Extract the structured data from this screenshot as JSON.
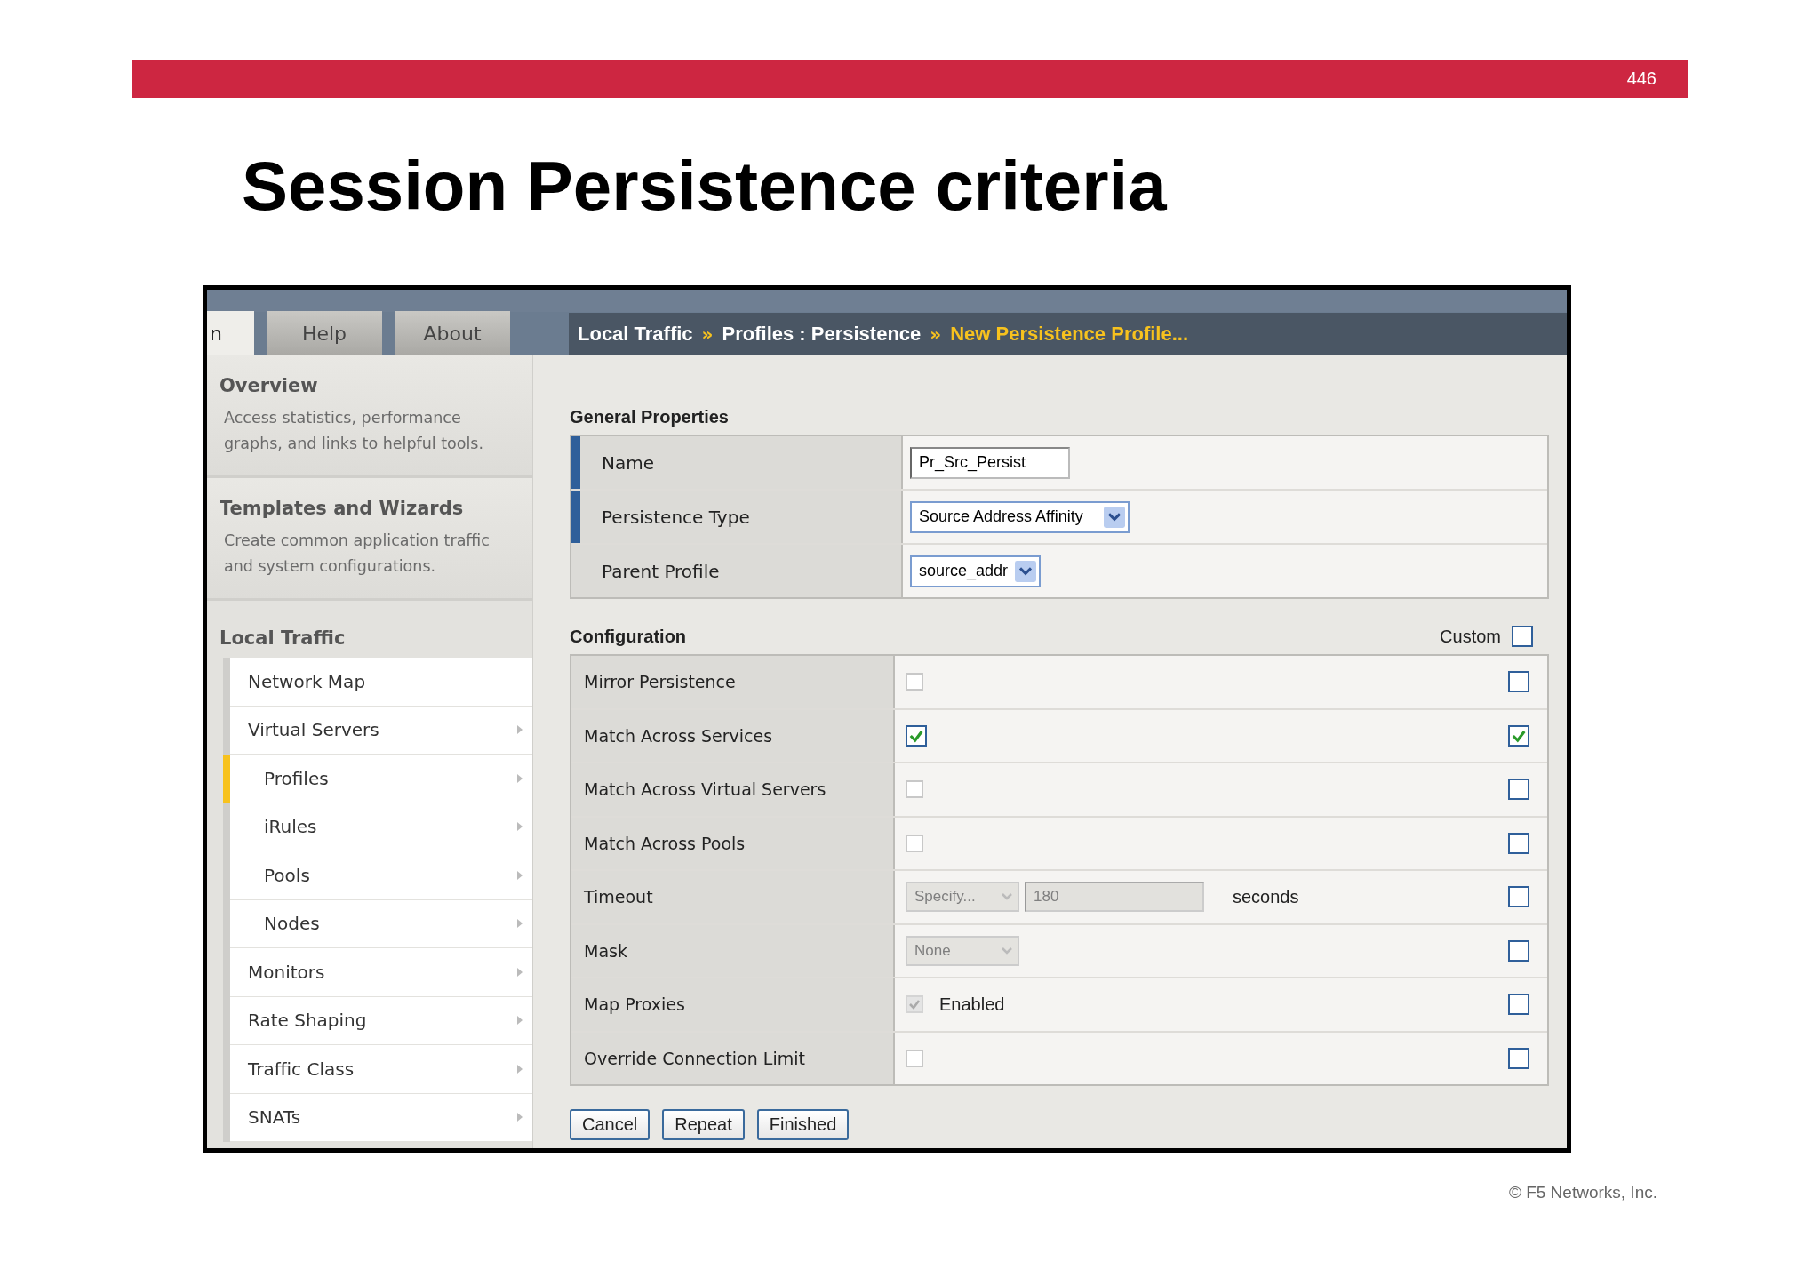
{
  "slide": {
    "page_number": "446",
    "title": "Session Persistence criteria",
    "footer": "© F5 Networks, Inc."
  },
  "app": {
    "tabs": [
      {
        "label": "n",
        "selected": true
      },
      {
        "label": "Help",
        "selected": false
      },
      {
        "label": "About",
        "selected": false
      }
    ],
    "breadcrumb": [
      {
        "text": "Local Traffic",
        "current": false
      },
      {
        "separator": "»",
        "text": "Profiles : Persistence",
        "current": false
      },
      {
        "separator": "»",
        "text": "New Persistence Profile...",
        "current": true
      }
    ],
    "sidebar": {
      "sections": [
        {
          "title": "Overview",
          "description": "Access statistics, performance graphs, and links to helpful tools."
        },
        {
          "title": "Templates and Wizards",
          "description": "Create common application traffic and system configurations."
        }
      ],
      "nav_title": "Local Traffic",
      "nav_items": [
        {
          "label": "Network Map",
          "selected": false,
          "has_arrow": false
        },
        {
          "label": "Virtual Servers",
          "selected": false,
          "has_arrow": true,
          "children": [
            {
              "label": "Profiles",
              "selected": true,
              "has_arrow": true
            },
            {
              "label": "iRules",
              "selected": false,
              "has_arrow": true
            },
            {
              "label": "Pools",
              "selected": false,
              "has_arrow": true
            },
            {
              "label": "Nodes",
              "selected": false,
              "has_arrow": true
            }
          ]
        },
        {
          "label": "Monitors",
          "selected": false,
          "has_arrow": true
        },
        {
          "label": "Rate Shaping",
          "selected": false,
          "has_arrow": true
        },
        {
          "label": "Traffic Class",
          "selected": false,
          "has_arrow": true
        },
        {
          "label": "SNATs",
          "selected": false,
          "has_arrow": true
        }
      ]
    },
    "general": {
      "title": "General Properties",
      "rows": [
        {
          "label": "Name",
          "required": true,
          "kind": "text",
          "value": "Pr_Src_Persist"
        },
        {
          "label": "Persistence Type",
          "required": true,
          "kind": "select",
          "value": "Source Address Affinity"
        },
        {
          "label": "Parent Profile",
          "required": false,
          "kind": "select",
          "value": "source_addr"
        }
      ]
    },
    "configuration": {
      "title": "Configuration",
      "custom_label": "Custom",
      "custom_checked": false,
      "rows": [
        {
          "label": "Mirror Persistence",
          "kind": "checkbox",
          "checked": false,
          "disabled": false,
          "custom": false
        },
        {
          "label": "Match Across Services",
          "kind": "checkbox",
          "checked": true,
          "disabled": false,
          "custom": true
        },
        {
          "label": "Match Across Virtual Servers",
          "kind": "checkbox",
          "checked": false,
          "disabled": false,
          "custom": false
        },
        {
          "label": "Match Across Pools",
          "kind": "checkbox",
          "checked": false,
          "disabled": false,
          "custom": false
        },
        {
          "label": "Timeout",
          "kind": "timeout",
          "select": "Specify...",
          "value": "180",
          "unit": "seconds",
          "disabled": true,
          "custom": false
        },
        {
          "label": "Mask",
          "kind": "select",
          "select": "None",
          "disabled": true,
          "custom": false
        },
        {
          "label": "Map Proxies",
          "kind": "checkbox",
          "checked": true,
          "disabled": true,
          "text": "Enabled",
          "custom": false
        },
        {
          "label": "Override Connection Limit",
          "kind": "checkbox",
          "checked": false,
          "disabled": false,
          "custom": false
        }
      ]
    },
    "buttons": [
      "Cancel",
      "Repeat",
      "Finished"
    ]
  }
}
